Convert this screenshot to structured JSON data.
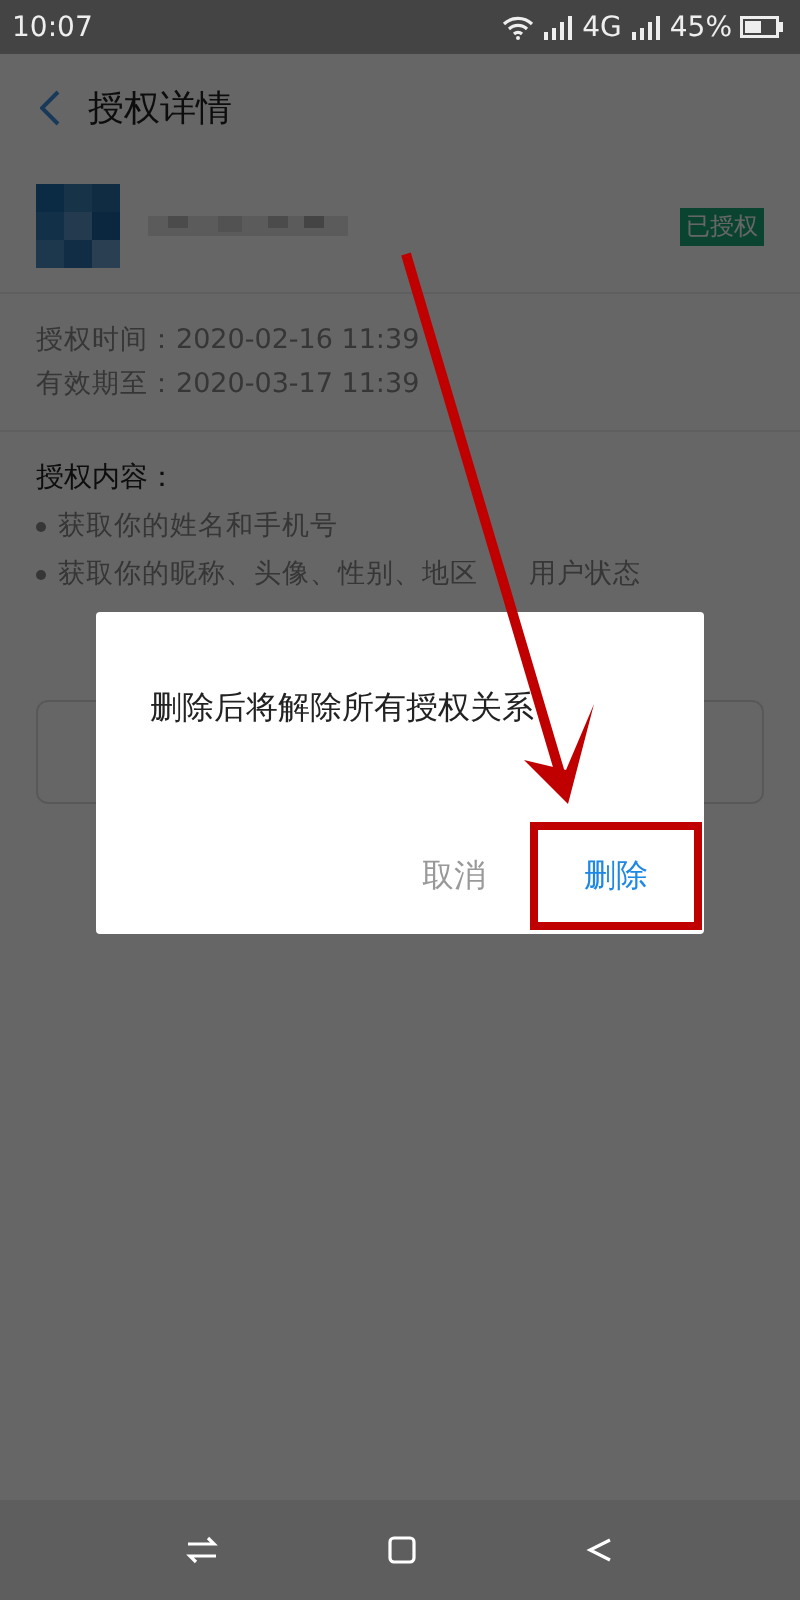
{
  "status_bar": {
    "time": "10:07",
    "network": "4G",
    "battery": "45%"
  },
  "header": {
    "title": "授权详情"
  },
  "app": {
    "badge": "已授权"
  },
  "times": [
    "授权时间：2020-02-16 11:39",
    "有效期至：2020-03-17 11:39"
  ],
  "permissions": {
    "heading": "授权内容：",
    "items": [
      {
        "parts": [
          "获取你的姓名和手机号"
        ]
      },
      {
        "parts": [
          "获取你的昵称、头像、性别、地区",
          "用户状态"
        ]
      }
    ]
  },
  "dialog": {
    "message": "删除后将解除所有授权关系",
    "buttons": [
      {
        "label": "取消",
        "kind": "cancel",
        "highlighted": false
      },
      {
        "label": "删除",
        "kind": "confirm",
        "highlighted": true
      }
    ]
  }
}
